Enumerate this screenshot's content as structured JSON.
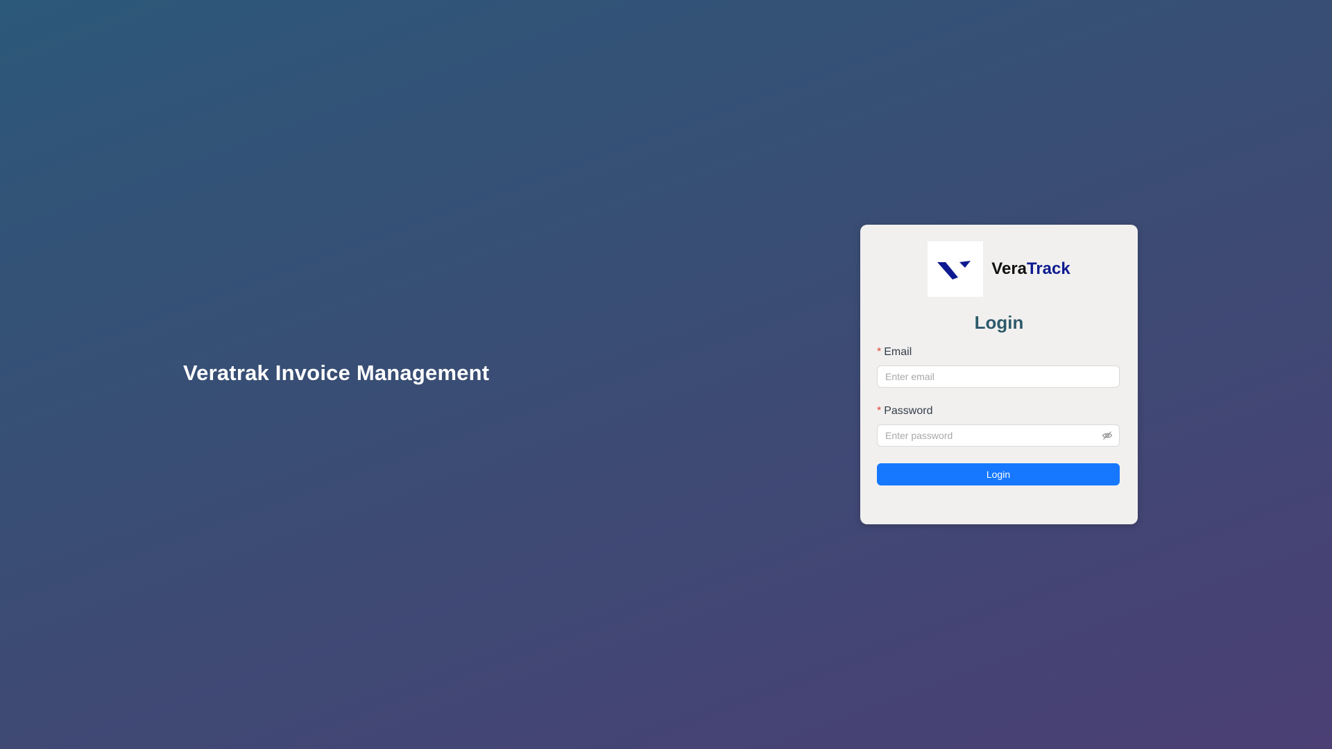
{
  "page": {
    "hero_title": "Veratrak Invoice Management"
  },
  "brand": {
    "name_part_1": "Vera",
    "name_part_2": "Track",
    "logo_icon": "veratrack-logo-icon",
    "logo_color": "#0e1a8f"
  },
  "login": {
    "title": "Login",
    "required_marker": "*",
    "email": {
      "label": "Email",
      "placeholder": "Enter email",
      "value": ""
    },
    "password": {
      "label": "Password",
      "placeholder": "Enter password",
      "value": "",
      "toggle_icon": "eye-hidden-icon"
    },
    "submit_label": "Login"
  },
  "colors": {
    "primary_button": "#1677ff",
    "title_color": "#2c5a6a",
    "card_background": "#f1f0ef"
  }
}
